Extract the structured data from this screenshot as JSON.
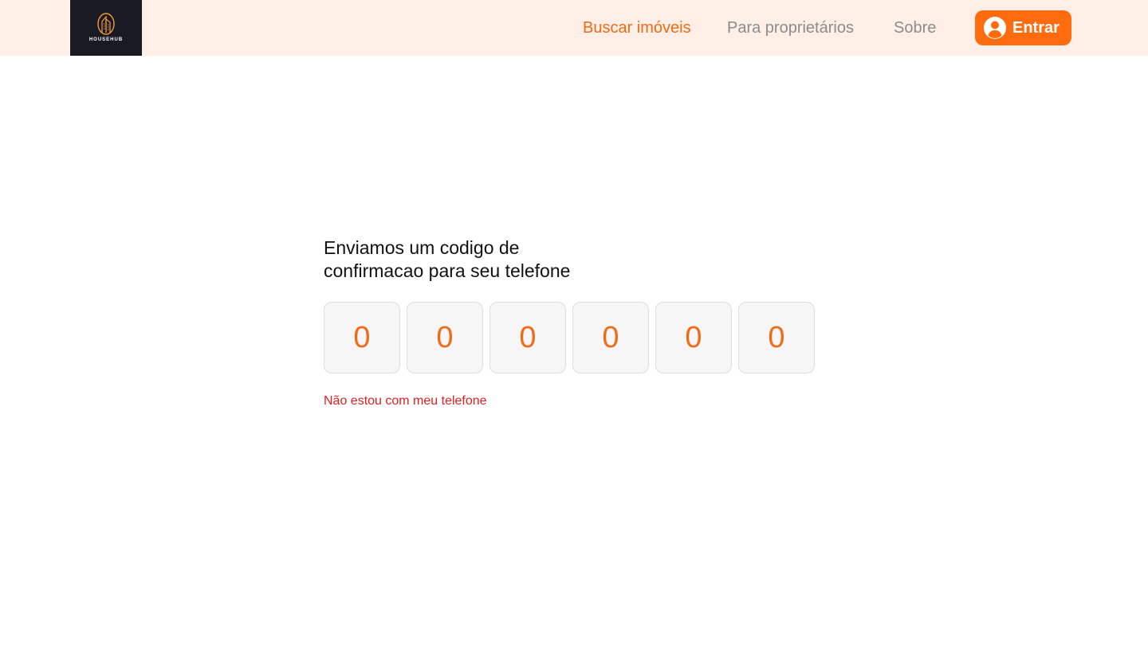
{
  "header": {
    "logo_text": "HOUSEHUB",
    "nav": [
      {
        "label": "Buscar imóveis",
        "active": true
      },
      {
        "label": "Para proprietários",
        "active": false
      },
      {
        "label": "Sobre",
        "active": false
      }
    ],
    "login_label": "Entrar",
    "login_icon": "user-circle-icon",
    "logo_icon": "building-icon"
  },
  "verification": {
    "title_line1": "Enviamos um codigo de",
    "title_line2": "confirmacao para seu telefone",
    "digits": [
      "0",
      "0",
      "0",
      "0",
      "0",
      "0"
    ],
    "no_phone_link": "Não estou com meu telefone"
  },
  "colors": {
    "header_bg": "#FFEFE6",
    "accent": "#FF6B0F",
    "logo_bg": "#1A1A24",
    "link_red": "#E02020"
  }
}
